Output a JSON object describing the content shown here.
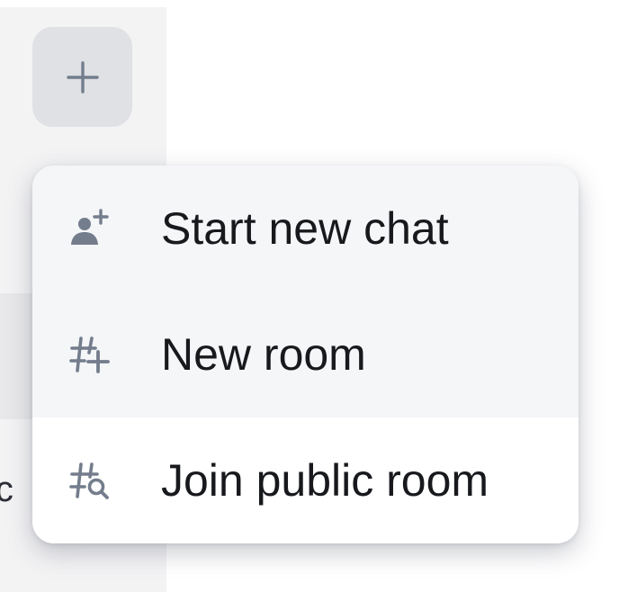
{
  "sidebar": {
    "clipped_text": "ic",
    "add_button": {
      "icon": "plus-icon"
    }
  },
  "menu": {
    "items": [
      {
        "label": "Start new chat",
        "icon": "person-add-icon"
      },
      {
        "label": "New room",
        "icon": "room-add-icon"
      },
      {
        "label": "Join public room",
        "icon": "room-search-icon"
      }
    ]
  },
  "colors": {
    "icon": "#737d8c",
    "text": "#17191c",
    "menu_item_highlight": "#f5f6f8",
    "button_bg": "#e0e1e5",
    "sidebar_bg": "#f3f3f4"
  }
}
